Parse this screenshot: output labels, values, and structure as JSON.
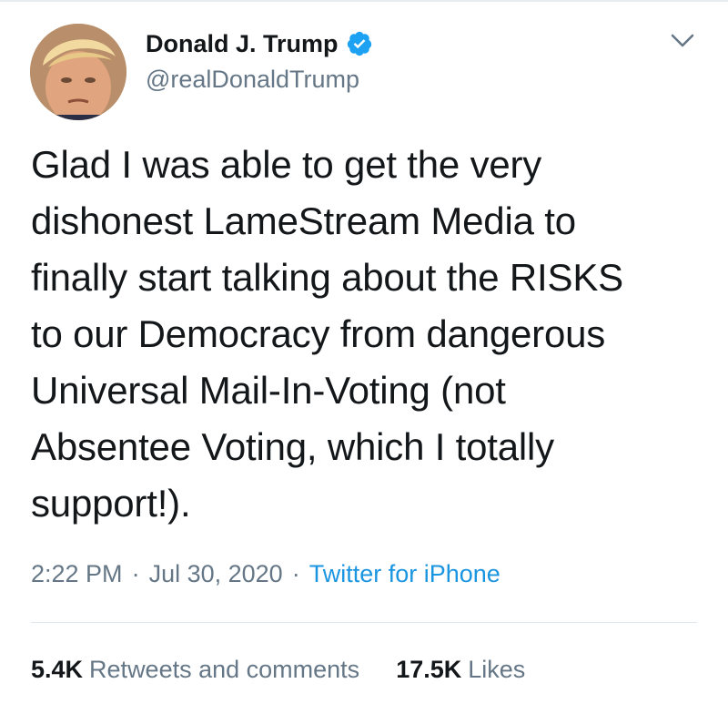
{
  "author": {
    "name": "Donald J. Trump",
    "handle": "@realDonaldTrump",
    "verified": true,
    "avatar_icon": "profile-photo"
  },
  "menu_icon": "chevron-down-icon",
  "tweet": {
    "text": "Glad I was able to get the very\ndishonest LameStream Media to\nfinally start talking about the RISKS\nto our Democracy from dangerous\nUniversal Mail-In-Voting (not\nAbsentee Voting, which I totally\nsupport!)."
  },
  "meta": {
    "time": "2:22 PM",
    "separator": "·",
    "date": "Jul 30, 2020",
    "source": "Twitter for iPhone"
  },
  "stats": {
    "retweets_count": "5.4K",
    "retweets_label": "Retweets and comments",
    "likes_count": "17.5K",
    "likes_label": "Likes"
  },
  "colors": {
    "text": "#14171a",
    "secondary": "#657786",
    "link": "#1b95e0",
    "verified": "#1da1f2",
    "divider": "#e1e8ed"
  }
}
